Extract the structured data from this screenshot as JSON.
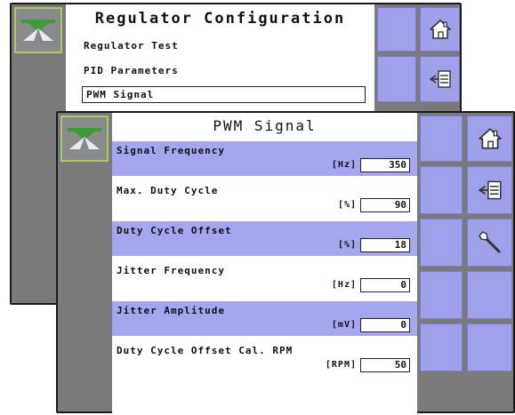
{
  "back_screen": {
    "title": "Regulator Configuration",
    "menu_items": [
      {
        "label": "Regulator Test",
        "selected": false
      },
      {
        "label": "PID Parameters",
        "selected": false
      },
      {
        "label": "PWM Signal",
        "selected": true
      }
    ],
    "side_buttons": [
      "home-icon",
      "back-icon"
    ]
  },
  "front_screen": {
    "title": "PWM Signal",
    "rows": [
      {
        "label": "Signal Frequency",
        "unit": "[Hz]",
        "value": "350",
        "shaded": true
      },
      {
        "label": "Max. Duty Cycle",
        "unit": "[%]",
        "value": "90",
        "shaded": false
      },
      {
        "label": "Duty Cycle Offset",
        "unit": "[%]",
        "value": "18",
        "shaded": true
      },
      {
        "label": "Jitter Frequency",
        "unit": "[Hz]",
        "value": "0",
        "shaded": false
      },
      {
        "label": "Jitter Amplitude",
        "unit": "[mV]",
        "value": "0",
        "shaded": true
      },
      {
        "label": "Duty Cycle Offset Cal. RPM",
        "unit": "[RPM]",
        "value": "50",
        "shaded": false
      }
    ],
    "side_buttons": [
      "home-icon",
      "back-icon",
      "wrench-icon"
    ]
  },
  "colors": {
    "tile": "#9fa0ea",
    "row_shade": "#a4a6ee",
    "screen_bezel": "#7a7a7a",
    "logo_border": "#a9c96a",
    "logo_green": "#3f9b3a"
  }
}
